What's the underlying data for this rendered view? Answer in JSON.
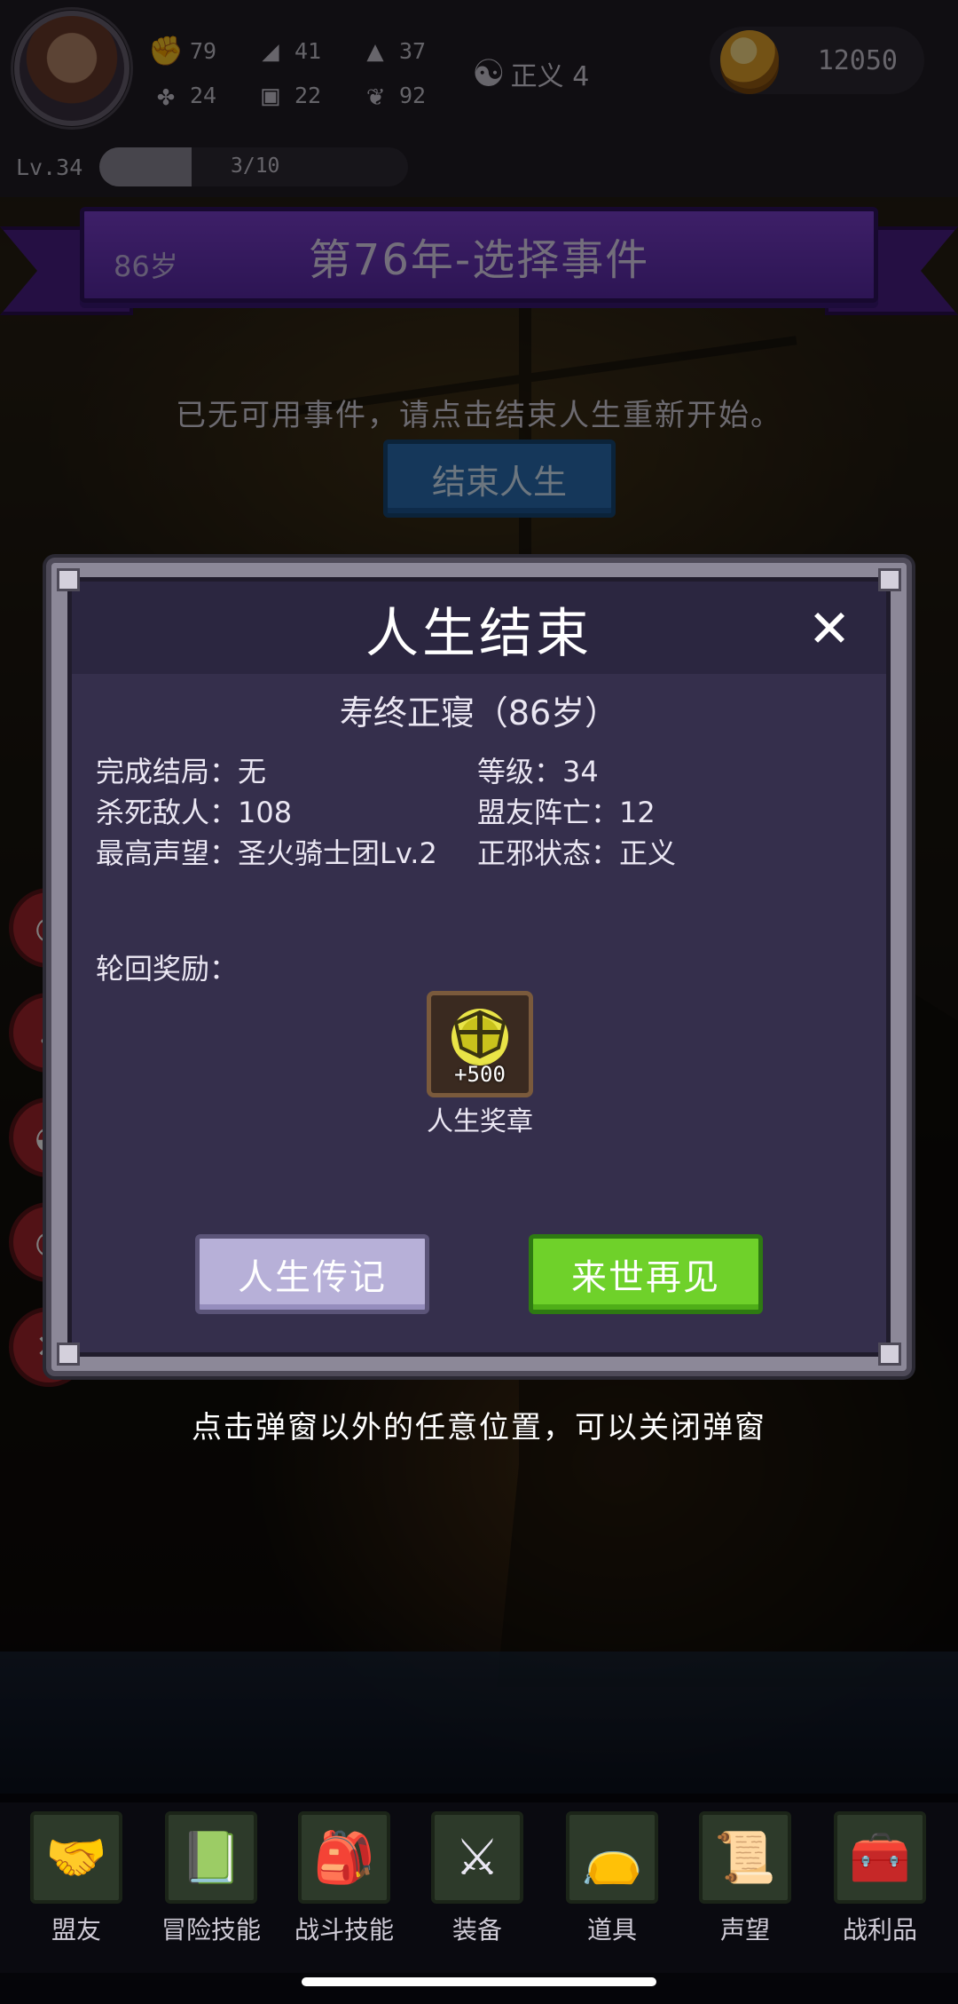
{
  "player": {
    "level_label": "Lv.34",
    "xp_text": "3/10",
    "xp_fraction": 0.3,
    "stats": [
      {
        "icon": "fist-icon",
        "value": "79"
      },
      {
        "icon": "boot-icon",
        "value": "41"
      },
      {
        "icon": "wizard-hat-icon",
        "value": "37"
      },
      {
        "icon": "clover-icon",
        "value": "24"
      },
      {
        "icon": "armor-icon",
        "value": "22"
      },
      {
        "icon": "lotus-icon",
        "value": "92"
      }
    ],
    "alignment": {
      "icon": "yin-yang-icon",
      "label": "正义 4"
    },
    "gold": "12050"
  },
  "header": {
    "age": "86岁",
    "title": "第76年-选择事件"
  },
  "event": {
    "message": "已无可用事件，请点击结束人生重新开始。",
    "end_life_button": "结束人生"
  },
  "modal": {
    "title": "人生结束",
    "close_icon": "close-icon",
    "death_cause": "寿终正寝（86岁）",
    "info": [
      "完成结局：无",
      "等级：34",
      "杀死敌人：108",
      "盟友阵亡：12",
      "最高声望：圣火骑士团Lv.2",
      "正邪状态：正义"
    ],
    "reward_label": "轮回奖励：",
    "reward": {
      "icon": "medal-icon",
      "count": "+500",
      "name": "人生奖章"
    },
    "biography_button": "人生传记",
    "next_life_button": "来世再见"
  },
  "hint": "点击弹窗以外的任意位置，可以关闭弹窗",
  "nav": [
    {
      "label": "盟友",
      "icon": "handshake-icon"
    },
    {
      "label": "冒险技能",
      "icon": "book-icon"
    },
    {
      "label": "战斗技能",
      "icon": "backpack-icon"
    },
    {
      "label": "装备",
      "icon": "crossed-swords-icon"
    },
    {
      "label": "道具",
      "icon": "pouch-icon"
    },
    {
      "label": "声望",
      "icon": "scroll-icon"
    },
    {
      "label": "战利品",
      "icon": "treasure-chest-icon"
    }
  ],
  "colors": {
    "ribbon": "#6a34be",
    "end_life_button": "#2a6fb4",
    "biography_button": "#b7b0d8",
    "next_life_button": "#6fd12a",
    "modal_bg": "#352f4c"
  }
}
